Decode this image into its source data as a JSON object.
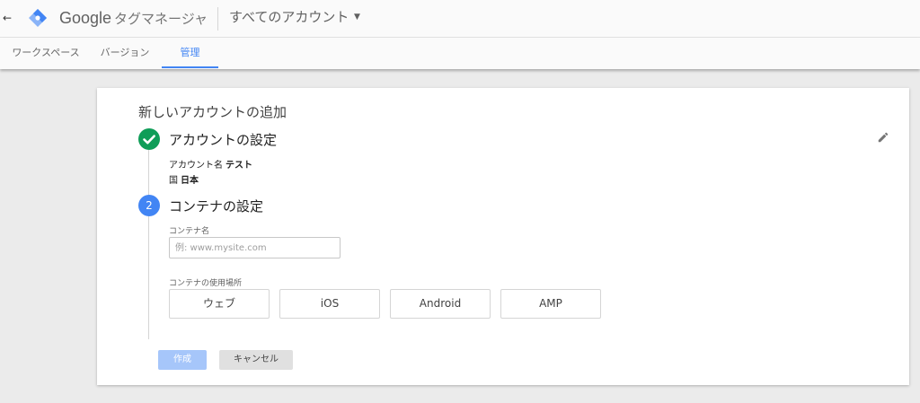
{
  "header": {
    "back_icon": "arrow-left-icon",
    "logo_icon": "tag-manager-logo-icon",
    "brand_google": "Google",
    "brand_product": "タグマネージャ",
    "account_selector": "すべてのアカウント",
    "caret_icon": "caret-down-icon"
  },
  "tabs": [
    {
      "label": "ワークスペース",
      "active": false
    },
    {
      "label": "バージョン",
      "active": false
    },
    {
      "label": "管理",
      "active": true
    }
  ],
  "card": {
    "title": "新しいアカウントの追加",
    "step1": {
      "title": "アカウントの設定",
      "status_icon": "check-circle-icon",
      "edit_icon": "pencil-icon",
      "account_name_label": "アカウント名",
      "account_name_value": "テスト",
      "country_label": "国",
      "country_value": "日本"
    },
    "step2": {
      "number": "2",
      "title": "コンテナの設定",
      "container_name_label": "コンテナ名",
      "container_name_placeholder": "例: www.mysite.com",
      "container_name_value": "",
      "usage_label": "コンテナの使用場所",
      "platforms": [
        "ウェブ",
        "iOS",
        "Android",
        "AMP"
      ]
    },
    "create_button": "作成",
    "cancel_button": "キャンセル"
  },
  "colors": {
    "accent": "#4285f4",
    "success": "#0f9d58",
    "create_disabled": "#a6c6fa",
    "background": "#ebebeb"
  }
}
